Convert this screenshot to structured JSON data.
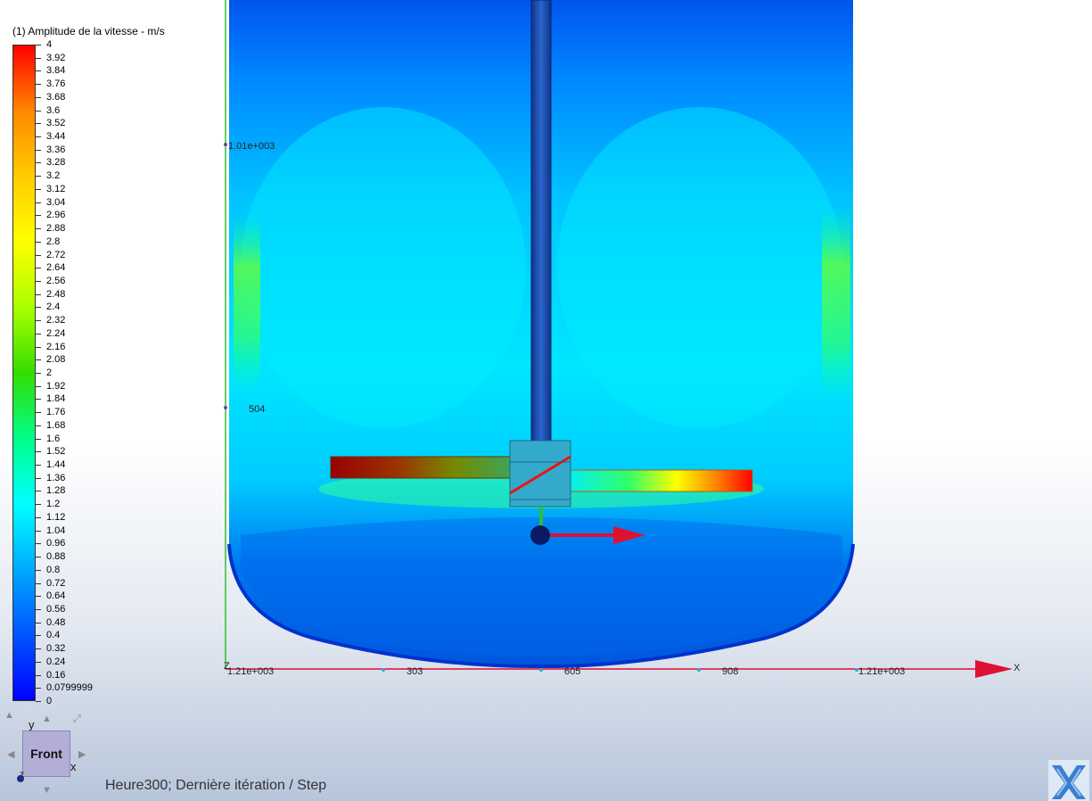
{
  "legend": {
    "title": "(1) Amplitude de la vitesse - m/s",
    "ticks": [
      "4",
      "3.92",
      "3.84",
      "3.76",
      "3.68",
      "3.6",
      "3.52",
      "3.44",
      "3.36",
      "3.28",
      "3.2",
      "3.12",
      "3.04",
      "2.96",
      "2.88",
      "2.8",
      "2.72",
      "2.64",
      "2.56",
      "2.48",
      "2.4",
      "2.32",
      "2.24",
      "2.16",
      "2.08",
      "2",
      "1.92",
      "1.84",
      "1.76",
      "1.68",
      "1.6",
      "1.52",
      "1.44",
      "1.36",
      "1.28",
      "1.2",
      "1.12",
      "1.04",
      "0.96",
      "0.88",
      "0.8",
      "0.72",
      "0.64",
      "0.56",
      "0.48",
      "0.4",
      "0.32",
      "0.24",
      "0.16",
      "0.0799999",
      "0"
    ],
    "min_color": "#0000ff",
    "max_color": "#ff0000"
  },
  "axes": {
    "y_labels": [
      "1.01e+003",
      "504"
    ],
    "x_labels": [
      "1.21e+003",
      "303",
      "605",
      "908",
      "1.21e+003"
    ],
    "x_axis_name": "X",
    "z_axis_name": "Z"
  },
  "view_cube": {
    "face_label": "Front",
    "y_label": "y",
    "x_label": "x",
    "z_label": "z"
  },
  "status": {
    "text": "Heure300; Dernière itération / Step"
  },
  "colors": {
    "axis_x": "#dd1133",
    "axis_y": "#33bb33",
    "hot_blade": "#ee0000"
  }
}
